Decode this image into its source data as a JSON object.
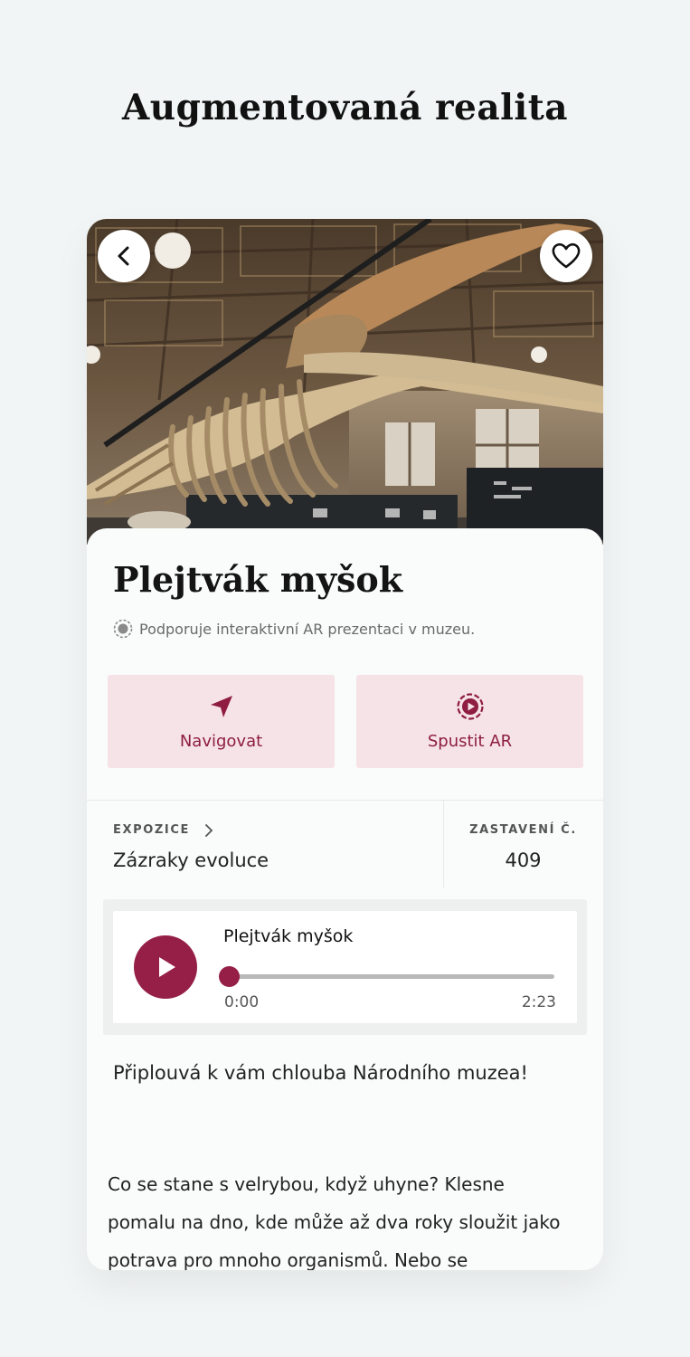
{
  "page": {
    "heading": "Augmentovaná realita"
  },
  "detail": {
    "title": "Plejtvák myšok",
    "ar_note": "Podporuje interaktivní AR prezentaci v muzeu.",
    "actions": {
      "navigate_label": "Navigovat",
      "start_ar_label": "Spustit AR"
    },
    "exposition": {
      "label": "EXPOZICE",
      "value": "Zázraky evoluce"
    },
    "stop": {
      "label": "ZASTAVENÍ Č.",
      "value": "409"
    },
    "audio": {
      "title": "Plejtvák myšok",
      "current_time": "0:00",
      "duration": "2:23",
      "progress": 0
    },
    "lead": "Připlouvá k vám chlouba Národního muzea!",
    "body": "Co se stane s velrybou, když uhyne? Klesne pomalu na dno, kde může až dva roky sloužit jako potrava pro mnoho organismů. Nebo se"
  },
  "icons": {
    "back": "chevron-left-icon",
    "favorite": "heart-icon",
    "ar": "ar-icon",
    "navigate": "navigation-arrow-icon",
    "start_ar": "play-circle-icon",
    "chevron": "chevron-right-icon",
    "play": "play-icon"
  },
  "colors": {
    "accent": "#951f46",
    "accent_light": "#f6e3e8",
    "background": "#f2f5f5"
  }
}
